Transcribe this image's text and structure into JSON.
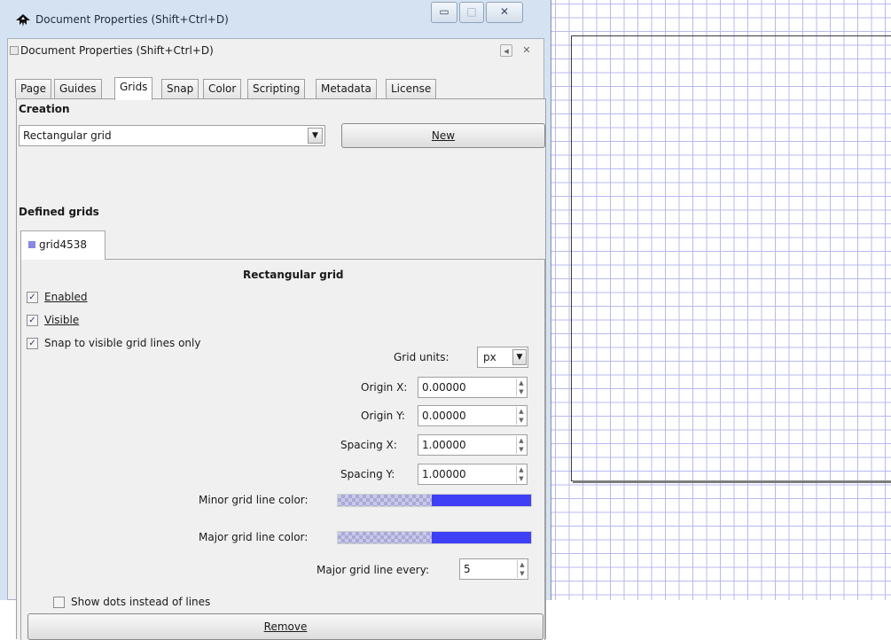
{
  "window": {
    "title": "Document Properties (Shift+Ctrl+D)",
    "buttons": {
      "minimize": "▭",
      "maximize": "□",
      "close": "✕"
    }
  },
  "dock": {
    "title": "Document Properties (Shift+Ctrl+D)",
    "btn_menu": "◂",
    "btn_close": "✕"
  },
  "tabs": [
    "Page",
    "Guides",
    "Grids",
    "Snap",
    "Color",
    "Scripting",
    "Metadata",
    "License"
  ],
  "active_tab": "Grids",
  "creation": {
    "title": "Creation",
    "grid_type": "Rectangular grid",
    "new_button": "New"
  },
  "defined_grids": {
    "title": "Defined grids",
    "grid_tab": "grid4538",
    "grid_color": "#8888e6"
  },
  "grid": {
    "title": "Rectangular grid",
    "enabled_label": "Enabled",
    "enabled": true,
    "visible_label": "Visible",
    "visible": true,
    "snap_label": "Snap to visible grid lines only",
    "snap": true,
    "units_label": "Grid units:",
    "units_value": "px",
    "origin_x_label": "Origin X:",
    "origin_x": "0.00000",
    "origin_y_label": "Origin Y:",
    "origin_y": "0.00000",
    "spacing_x_label": "Spacing X:",
    "spacing_x": "1.00000",
    "spacing_y_label": "Spacing Y:",
    "spacing_y": "1.00000",
    "minor_color_label": "Minor grid line color:",
    "minor_color": "#3f3ff6",
    "major_color_label": "Major grid line color:",
    "major_color": "#3f3ff6",
    "major_every_label": "Major grid line every:",
    "major_every": "5",
    "dots_label": "Show dots instead of lines",
    "dots": false,
    "remove_button": "Remove"
  },
  "canvas": {
    "grid_line_color": "#b9b9f0"
  }
}
